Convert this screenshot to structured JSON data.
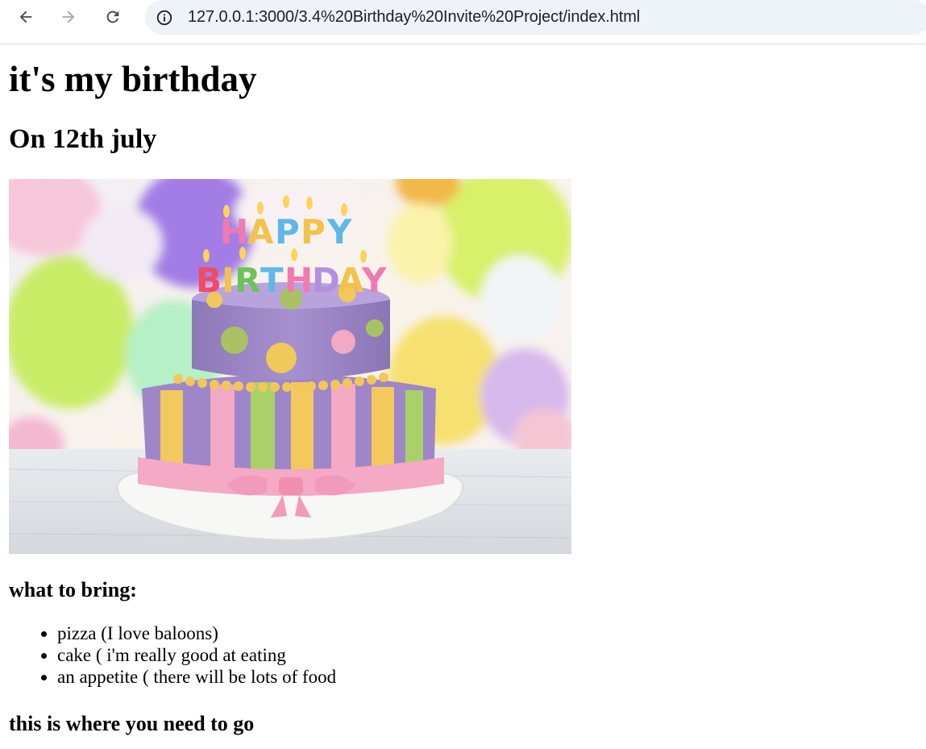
{
  "browser": {
    "url": "127.0.0.1:3000/3.4%20Birthday%20Invite%20Project/index.html",
    "icons": {
      "back": "arrow-left-icon",
      "forward": "arrow-right-icon",
      "reload": "reload-icon",
      "site_info": "info-icon"
    }
  },
  "page": {
    "title": "it's my birthday",
    "date_heading": "On 12th july",
    "image_text": "HAPPY BIRTHDAY",
    "bring_heading": "what to bring:",
    "bring_items": [
      "pizza (I love baloons)",
      "cake ( i'm really good at eating",
      "an appetite ( there will be lots of food"
    ],
    "where_heading": "this is where you need to go"
  },
  "colors": {
    "toolbar_bg": "#ffffff",
    "omnibox_bg": "#eef2f9",
    "text": "#000000"
  }
}
